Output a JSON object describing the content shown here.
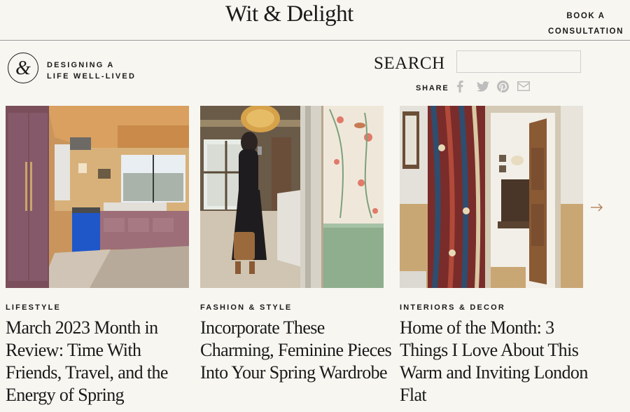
{
  "header": {
    "logo_text": "Wit & Delight",
    "book_button": "BOOK A CONSULTATION"
  },
  "tagline": {
    "line1": "DESIGNING A",
    "line2": "LIFE WELL-LIVED"
  },
  "search": {
    "label": "SEARCH",
    "value": "",
    "placeholder": ""
  },
  "share": {
    "label": "SHARE",
    "icons": [
      "facebook-icon",
      "twitter-icon",
      "pinterest-icon",
      "email-icon"
    ]
  },
  "cards": [
    {
      "category": "LIFESTYLE",
      "title": "March 2023 Month in Review: Time With Friends, Travel, and the Energy of Spring",
      "image": "kitchen-photo"
    },
    {
      "category": "FASHION & STYLE",
      "title": "Incorporate These Charming, Feminine Pieces Into Your Spring Wardrobe",
      "image": "mirror-selfie-photo"
    },
    {
      "category": "INTERIORS & DECOR",
      "title": "Home of the Month: 3 Things I Love About This Warm and Inviting London Flat",
      "image": "hallway-curtain-photo"
    }
  ],
  "carousel": {
    "next_icon": "arrow-right-icon"
  },
  "colors": {
    "background": "#f7f6f1",
    "text": "#1a1a1a",
    "accent": "#b07a4f",
    "share_icon": "#bdbdbd"
  }
}
